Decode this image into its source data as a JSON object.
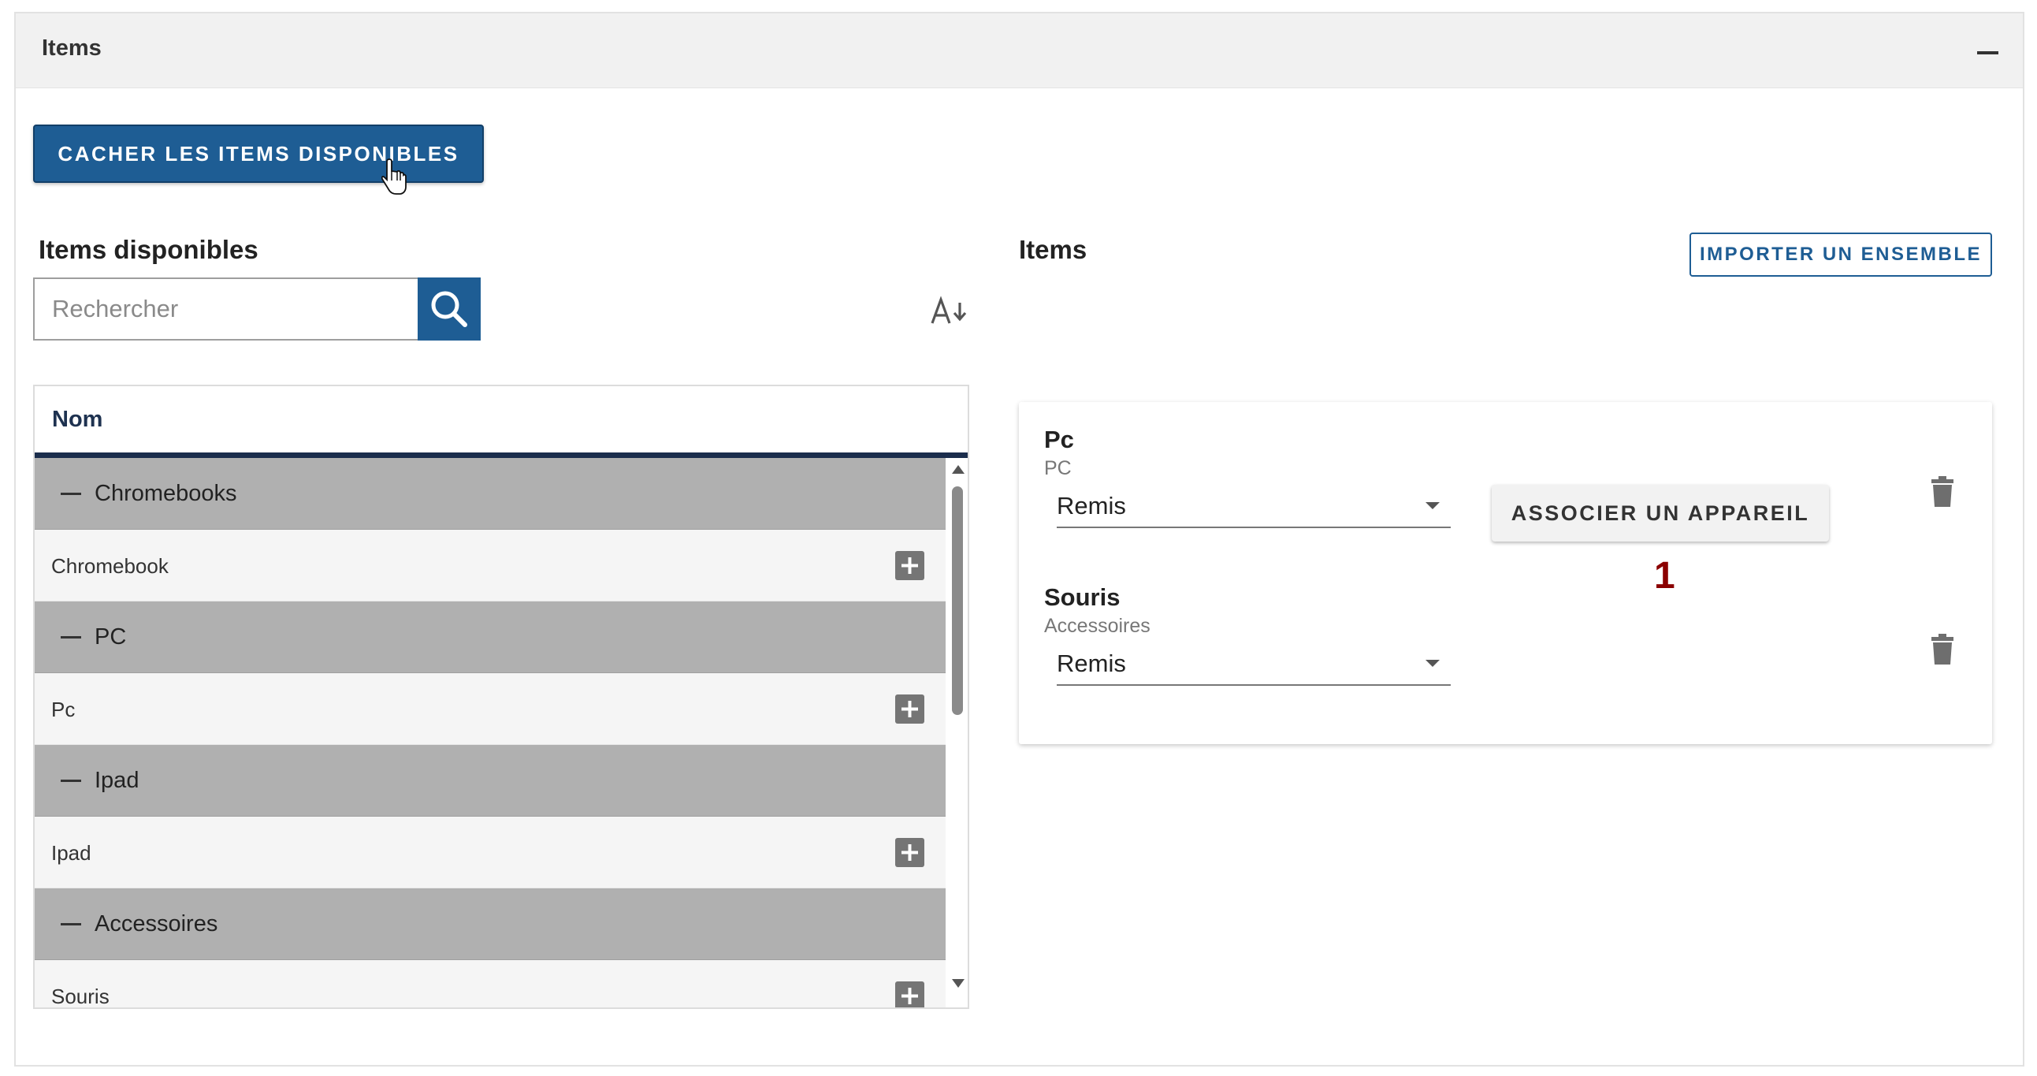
{
  "panel": {
    "title": "Items",
    "toggle_button_label": "CACHER LES ITEMS DISPONIBLES"
  },
  "available": {
    "title": "Items disponibles",
    "search_placeholder": "Rechercher",
    "column_name": "Nom",
    "groups": [
      {
        "label": "Chromebooks",
        "item": "Chromebook"
      },
      {
        "label": "PC",
        "item": "Pc"
      },
      {
        "label": "Ipad",
        "item": "Ipad"
      },
      {
        "label": "Accessoires",
        "item": "Souris"
      }
    ]
  },
  "items": {
    "title": "Items",
    "import_button_label": "IMPORTER UN ENSEMBLE",
    "entries": [
      {
        "name": "Pc",
        "category": "PC",
        "status": "Remis",
        "associate_label": "ASSOCIER UN APPAREIL",
        "associate_count": "1"
      },
      {
        "name": "Souris",
        "category": "Accessoires",
        "status": "Remis"
      }
    ]
  },
  "colors": {
    "primary": "#1e5d94",
    "group_row": "#b0b0b0",
    "item_row": "#f5f5f5",
    "header_underline": "#1b2d4c",
    "badge": "#8b0000"
  },
  "icons": [
    "minus-icon",
    "pointer-cursor-icon",
    "search-icon",
    "sort-alpha-down-icon",
    "plus-square-icon",
    "trash-icon",
    "scroll-up-arrow-icon",
    "scroll-down-arrow-icon"
  ]
}
